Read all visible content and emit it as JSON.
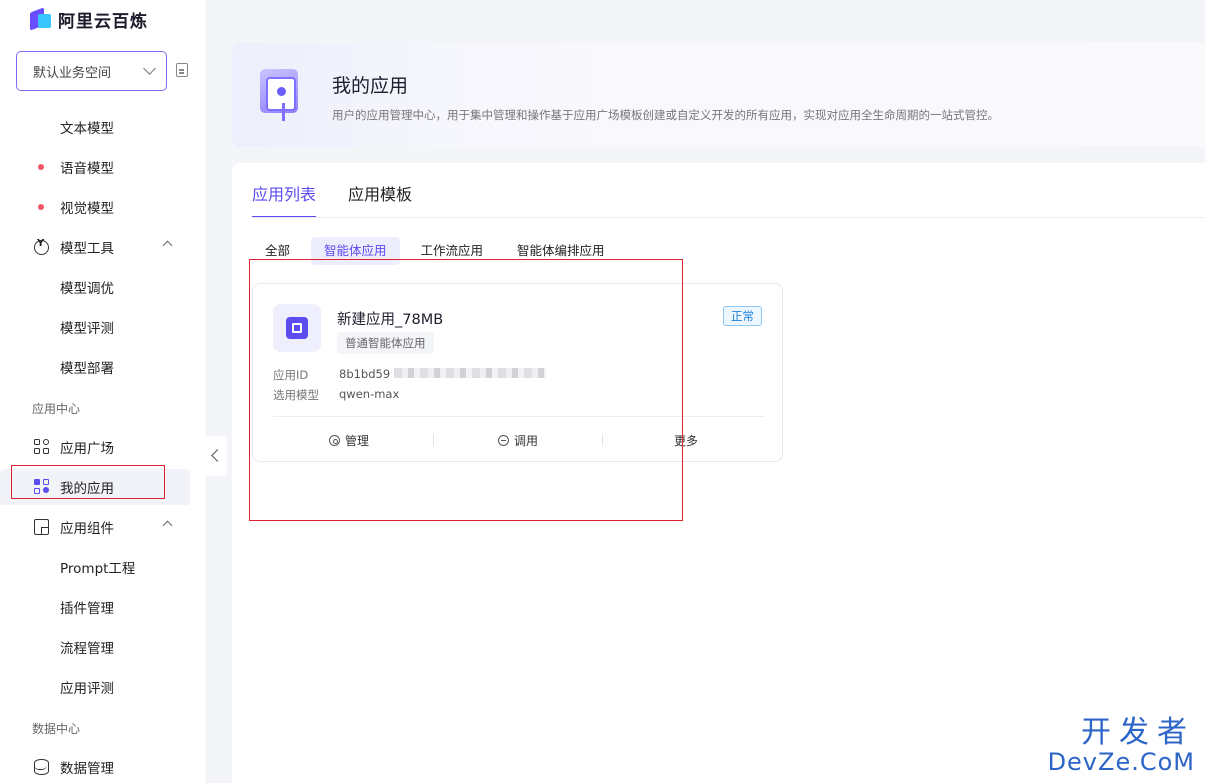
{
  "brand": {
    "name": "阿里云百炼"
  },
  "workspace": {
    "label": "默认业务空间"
  },
  "sidebar": {
    "items": [
      {
        "label": "文本模型",
        "type": "sub"
      },
      {
        "label": "语音模型",
        "type": "dot"
      },
      {
        "label": "视觉模型",
        "type": "dot"
      },
      {
        "label": "模型工具",
        "type": "group"
      },
      {
        "label": "模型调优",
        "type": "sub"
      },
      {
        "label": "模型评测",
        "type": "sub"
      },
      {
        "label": "模型部署",
        "type": "sub"
      }
    ],
    "section_app": "应用中心",
    "app_items": [
      {
        "label": "应用广场"
      },
      {
        "label": "我的应用"
      },
      {
        "label": "应用组件"
      },
      {
        "label": "Prompt工程"
      },
      {
        "label": "插件管理"
      },
      {
        "label": "流程管理"
      },
      {
        "label": "应用评测"
      }
    ],
    "section_data": "数据中心",
    "data_items": [
      {
        "label": "数据管理"
      }
    ]
  },
  "header": {
    "title": "我的应用",
    "description": "用户的应用管理中心，用于集中管理和操作基于应用广场模板创建或自定义开发的所有应用，实现对应用全生命周期的一站式管控。"
  },
  "tabs": [
    {
      "label": "应用列表",
      "active": true
    },
    {
      "label": "应用模板",
      "active": false
    }
  ],
  "filters": [
    {
      "label": "全部",
      "active": false
    },
    {
      "label": "智能体应用",
      "active": true
    },
    {
      "label": "工作流应用",
      "active": false
    },
    {
      "label": "智能体编排应用",
      "active": false
    }
  ],
  "app_card": {
    "name": "新建应用_78MB",
    "type_tag": "普通智能体应用",
    "status": "正常",
    "id_label": "应用ID",
    "id_value": "8b1bd59",
    "model_label": "选用模型",
    "model_value": "qwen-max",
    "actions": {
      "manage": "管理",
      "invoke": "调用",
      "more": "更多"
    }
  },
  "watermark": {
    "top": "开发者",
    "bottom": "DevZe.CoM"
  },
  "colors": {
    "accent": "#5b4cf0",
    "highlight_box": "#e0242f",
    "status": "#1c7fd6"
  }
}
